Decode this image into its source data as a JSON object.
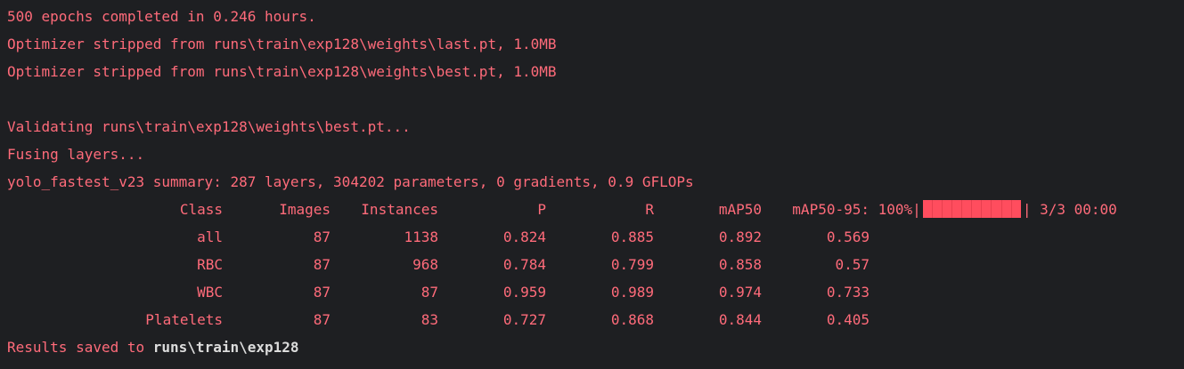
{
  "output": {
    "line1": "500 epochs completed in 0.246 hours.",
    "line2": "Optimizer stripped from runs\\train\\exp128\\weights\\last.pt, 1.0MB",
    "line3": "Optimizer stripped from runs\\train\\exp128\\weights\\best.pt, 1.0MB",
    "line4": "Validating runs\\train\\exp128\\weights\\best.pt...",
    "line5": "Fusing layers...",
    "line6": "yolo_fastest_v23 summary: 287 layers, 304202 parameters, 0 gradients, 0.9 GFLOPs"
  },
  "table": {
    "header": {
      "class": "Class",
      "images": "Images",
      "instances": "Instances",
      "p": "P",
      "r": "R",
      "map50": "mAP50",
      "map50_95": "mAP50-95:",
      "progress_pct": "100%|",
      "progress_end": "| 3/3 00:00",
      "progress_value": 1.0
    },
    "rows": [
      {
        "class": "all",
        "images": "87",
        "instances": "1138",
        "p": "0.824",
        "r": "0.885",
        "map50": "0.892",
        "map50_95": "0.569"
      },
      {
        "class": "RBC",
        "images": "87",
        "instances": "968",
        "p": "0.784",
        "r": "0.799",
        "map50": "0.858",
        "map50_95": "0.57"
      },
      {
        "class": "WBC",
        "images": "87",
        "instances": "87",
        "p": "0.959",
        "r": "0.989",
        "map50": "0.974",
        "map50_95": "0.733"
      },
      {
        "class": "Platelets",
        "images": "87",
        "instances": "83",
        "p": "0.727",
        "r": "0.868",
        "map50": "0.844",
        "map50_95": "0.405"
      }
    ]
  },
  "results": {
    "prefix": "Results saved to ",
    "path": "runs\\train\\exp128"
  },
  "colors": {
    "background": "#1e1f22",
    "text_red": "#ff6b7a",
    "progress_fill": "#ff4d5e",
    "path_text": "#dcdcdc"
  }
}
